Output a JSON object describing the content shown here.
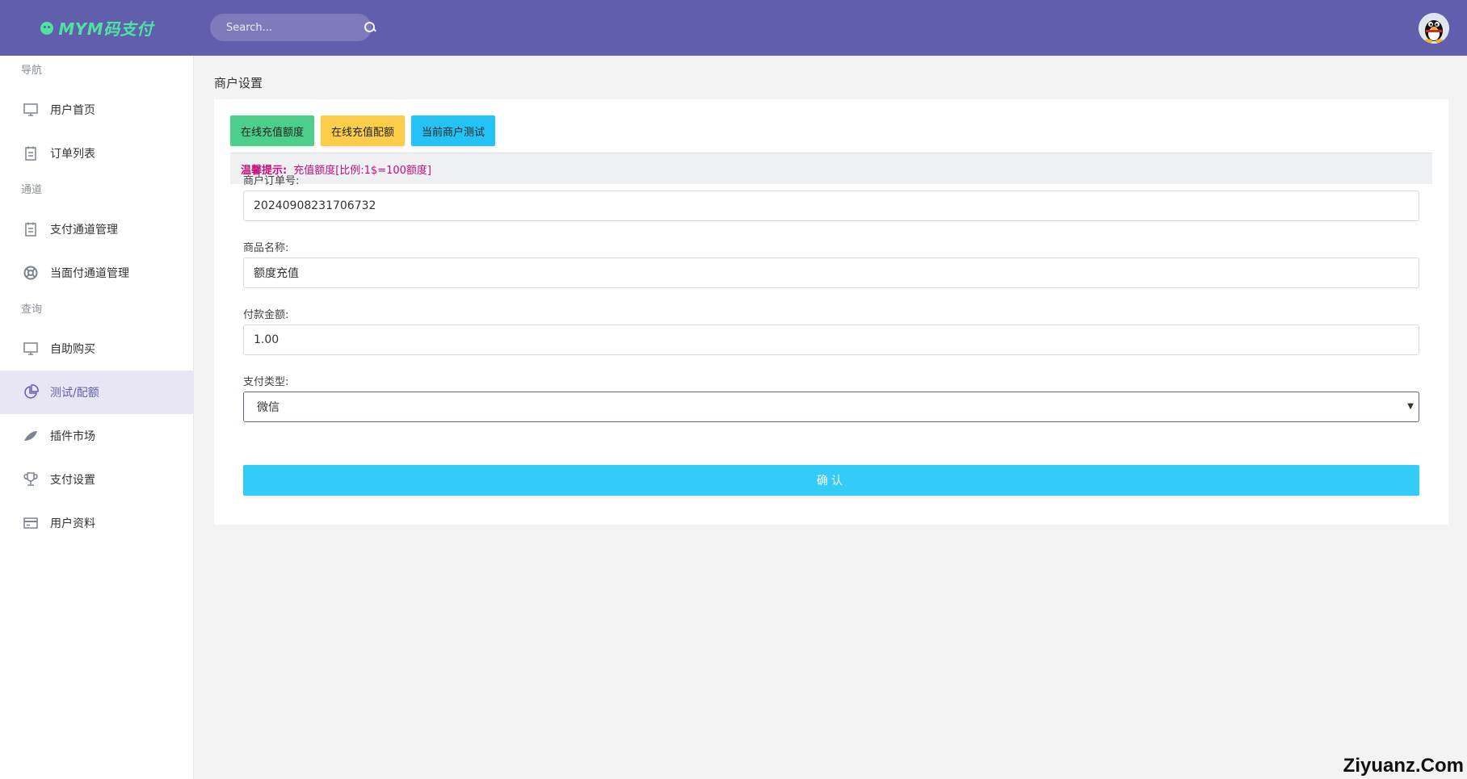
{
  "brand": {
    "name": "MYM码支付"
  },
  "search": {
    "placeholder": "Search..."
  },
  "sidebar": {
    "sections": [
      {
        "title": "导航",
        "items": [
          {
            "label": "用户首页",
            "icon": "monitor-icon"
          },
          {
            "label": "订单列表",
            "icon": "clipboard-icon"
          }
        ]
      },
      {
        "title": "通道",
        "items": [
          {
            "label": "支付通道管理",
            "icon": "clipboard-icon"
          },
          {
            "label": "当面付通道管理",
            "icon": "lifebuoy-icon"
          }
        ]
      },
      {
        "title": "查询",
        "items": [
          {
            "label": "自助购买",
            "icon": "monitor-icon"
          },
          {
            "label": "测试/配额",
            "icon": "pie-chart-icon",
            "active": true
          },
          {
            "label": "插件市场",
            "icon": "leaf-icon"
          },
          {
            "label": "支付设置",
            "icon": "trophy-icon"
          },
          {
            "label": "用户资料",
            "icon": "credit-card-icon"
          }
        ]
      }
    ]
  },
  "page": {
    "title": "商户设置"
  },
  "buttons": {
    "recharge_quota": "在线充值额度",
    "recharge_config": "在线充值配额",
    "merchant_test": "当前商户测试"
  },
  "tip": {
    "label": "温馨提示:",
    "text": "充值额度[比例:1$=100额度]"
  },
  "form": {
    "order_no_label": "商户订单号:",
    "order_no_value": "20240908231706732",
    "product_label": "商品名称:",
    "product_value": "额度充值",
    "amount_label": "付款金额:",
    "amount_value": "1.00",
    "pay_type_label": "支付类型:",
    "pay_type_value": "微信",
    "confirm_label": "确认"
  },
  "watermark": "Ziyuanz.Com",
  "colors": {
    "topbar": "#615ead",
    "brand": "#4fe3a0",
    "green": "#4ccf8a",
    "yellow": "#fccd48",
    "blue": "#25c2f5",
    "confirm": "#33cbf8",
    "tip": "#c0117d"
  }
}
